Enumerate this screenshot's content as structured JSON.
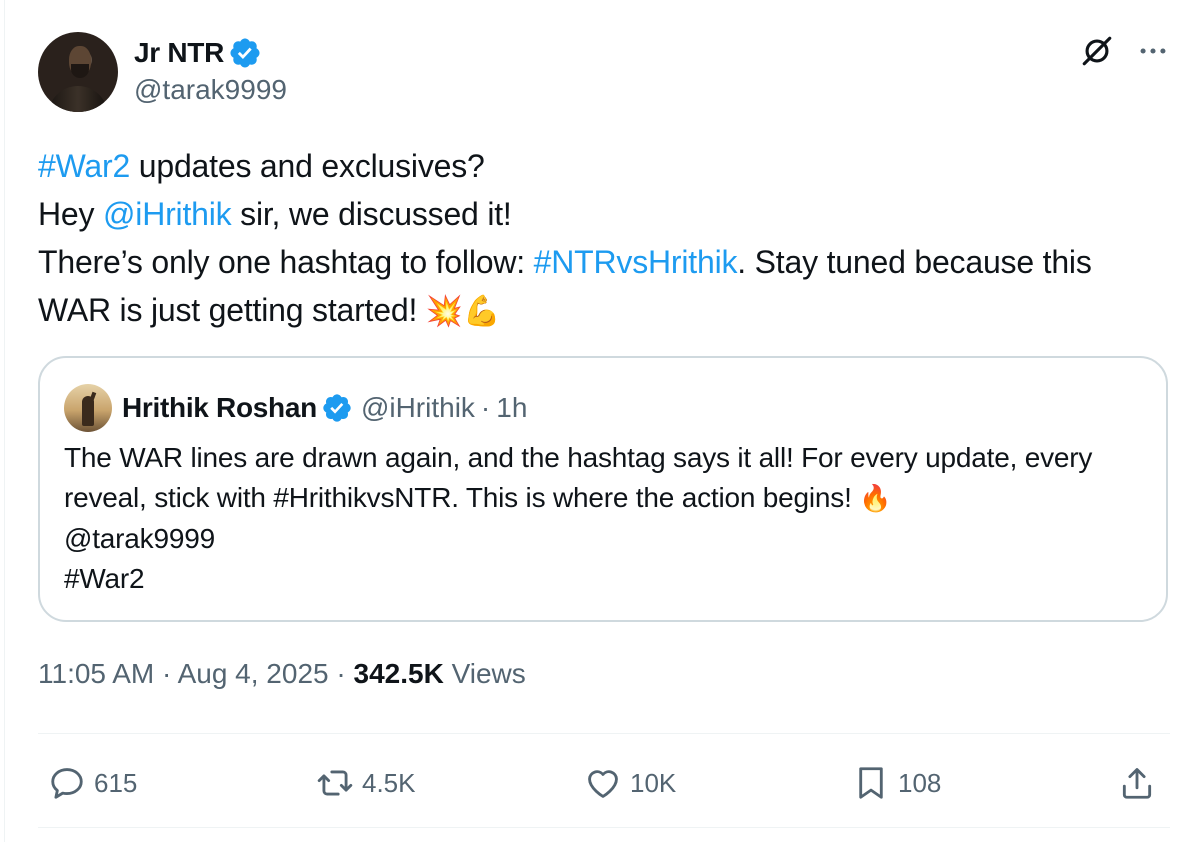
{
  "author": {
    "name": "Jr NTR",
    "handle": "@tarak9999",
    "verified": true
  },
  "tweet": {
    "lines": [
      [
        {
          "text": "#War2",
          "link": true
        },
        {
          "text": " updates and exclusives?",
          "link": false
        }
      ],
      [
        {
          "text": "Hey ",
          "link": false
        },
        {
          "text": "@iHrithik",
          "link": true
        },
        {
          "text": " sir, we discussed it!",
          "link": false
        }
      ],
      [
        {
          "text": "There’s only one hashtag to follow: ",
          "link": false
        },
        {
          "text": "#NTRvsHrithik",
          "link": true
        },
        {
          "text": ". Stay tuned because this WAR is just getting started! ",
          "link": false
        },
        {
          "text": "💥💪",
          "emoji": true
        }
      ]
    ]
  },
  "quote": {
    "name": "Hrithik Roshan",
    "handle": "@iHrithik",
    "separator": "·",
    "time": "1h",
    "line1": "The WAR lines are drawn again, and the hashtag says it all! For every update, every reveal, stick with #HrithikvsNTR. This is where the action begins! ",
    "emoji": "🔥",
    "line2": "@tarak9999",
    "line3": "#War2"
  },
  "meta": {
    "time": "11:05 AM",
    "dot1": " · ",
    "date": "Aug 4, 2025",
    "dot2": " · ",
    "views_count": "342.5K",
    "views_label": " Views"
  },
  "actions": {
    "replies": "615",
    "reposts": "4.5K",
    "likes": "10K",
    "bookmarks": "108"
  },
  "icons": [
    "verified-badge-icon",
    "grok-icon",
    "more-icon",
    "reply-icon",
    "repost-icon",
    "like-icon",
    "bookmark-icon",
    "share-icon"
  ],
  "colors": {
    "link": "#1d9bf0",
    "secondary_text": "#536471",
    "primary_text": "#0f1419",
    "border": "#cfd9de"
  }
}
